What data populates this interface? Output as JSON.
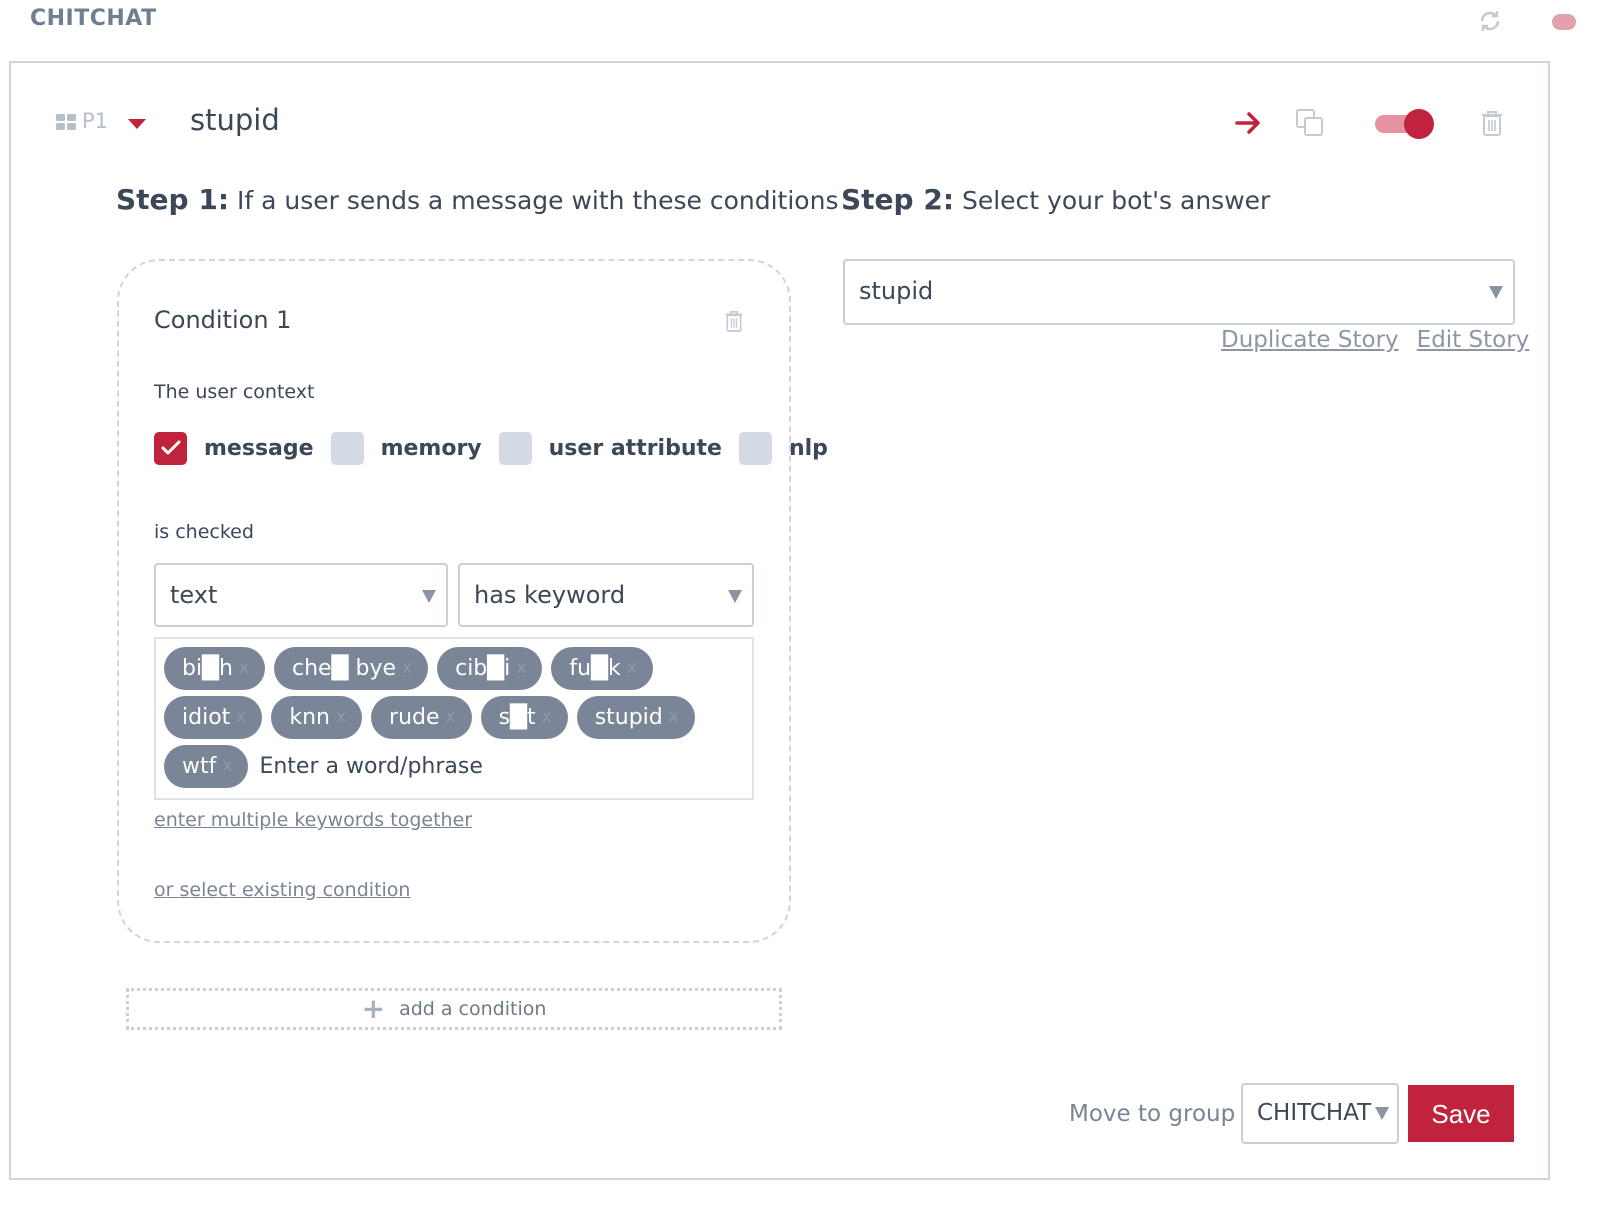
{
  "app": {
    "group_title": "CHITCHAT"
  },
  "story": {
    "priority": "P1",
    "name": "stupid"
  },
  "step1": {
    "label": "Step 1:",
    "text": "If a user sends a message with these conditions"
  },
  "step2": {
    "label": "Step 2:",
    "text": "Select your bot's answer"
  },
  "condition": {
    "title": "Condition 1",
    "context_label": "The user context",
    "checkboxes": [
      {
        "label": "message",
        "checked": true
      },
      {
        "label": "memory",
        "checked": false
      },
      {
        "label": "user attribute",
        "checked": false
      },
      {
        "label": "nlp",
        "checked": false
      }
    ],
    "is_checked_label": "is checked",
    "field_select": "text",
    "operator_select": "has keyword",
    "keywords": [
      "bi█h",
      "che█ bye",
      "cib█i",
      "fu█k",
      "idiot",
      "knn",
      "rude",
      "s█t",
      "stupid",
      "wtf"
    ],
    "keyword_remove": "x",
    "keyword_placeholder": "Enter a word/phrase",
    "multi_link": "enter multiple keywords together",
    "existing_link": "or select existing condition"
  },
  "add_condition": "add a condition",
  "answer": {
    "selected": "stupid",
    "duplicate_link": "Duplicate Story",
    "edit_link": "Edit Story"
  },
  "footer": {
    "move_label": "Move to group",
    "group_select": "CHITCHAT",
    "save_label": "Save"
  },
  "colors": {
    "accent": "#c0243c",
    "tag_bg": "#7a8698",
    "text": "#3c4858"
  },
  "icons": [
    "refresh-icon",
    "grid-icon",
    "caret-down-icon",
    "arrow-right-icon",
    "copy-icon",
    "trash-icon",
    "checkmark-icon",
    "plus-icon"
  ]
}
